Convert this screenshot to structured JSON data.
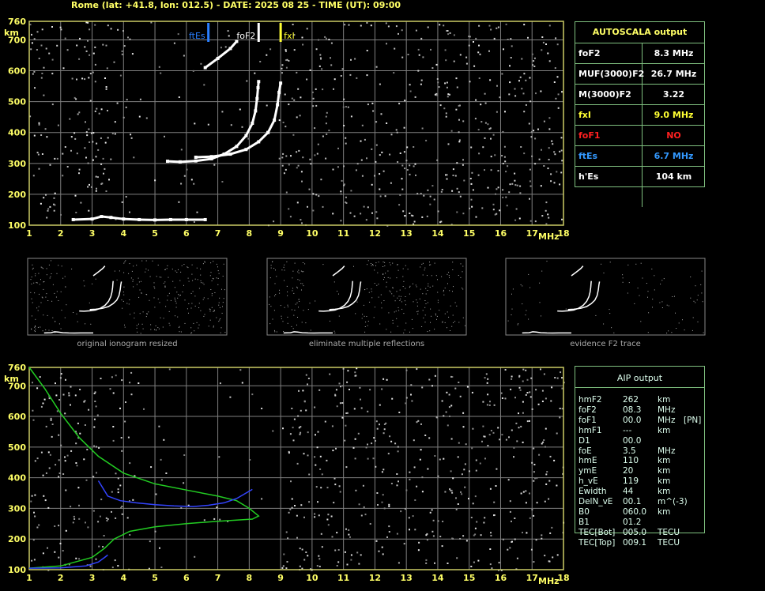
{
  "header": "Rome (lat: +41.8, lon: 012.5) - DATE: 2025 08 25 - TIME (UT): 09:00",
  "chart_data": [
    {
      "type": "scatter",
      "title": "",
      "xlabel": "MHz",
      "ylabel": "km",
      "xlim": [
        1,
        18
      ],
      "ylim": [
        100,
        760
      ],
      "xticks": [
        1,
        2,
        3,
        4,
        5,
        6,
        7,
        8,
        9,
        10,
        11,
        12,
        13,
        14,
        15,
        16,
        17,
        18
      ],
      "yticks": [
        100,
        200,
        300,
        400,
        500,
        600,
        700,
        760
      ],
      "grid": true,
      "markers": [
        {
          "name": "ftEs",
          "x": 6.7,
          "color": "#2a7fff"
        },
        {
          "name": "foF2",
          "x": 8.3,
          "color": "#ffffff"
        },
        {
          "name": "fxI",
          "x": 9.0,
          "color": "#ffff33"
        }
      ],
      "series": [
        {
          "name": "",
          "x": [
            5.4,
            5.8,
            6.3,
            6.8,
            7.2,
            7.6,
            7.9,
            8.1,
            8.2,
            8.25,
            8.28,
            8.3
          ],
          "y": [
            307,
            305,
            308,
            315,
            330,
            355,
            390,
            430,
            470,
            510,
            545,
            565
          ]
        },
        {
          "name": "",
          "x": [
            6.3,
            6.8,
            7.4,
            7.9,
            8.3,
            8.6,
            8.8,
            8.9,
            8.95,
            9.0
          ],
          "y": [
            320,
            322,
            330,
            345,
            370,
            400,
            440,
            490,
            530,
            560
          ]
        },
        {
          "name": "",
          "x": [
            2.4,
            3.0,
            3.3,
            3.6,
            4.0,
            4.5,
            5.0,
            5.5,
            6.0,
            6.6
          ],
          "y": [
            118,
            120,
            128,
            125,
            120,
            118,
            117,
            118,
            118,
            118
          ]
        },
        {
          "name": "",
          "x": [
            6.6,
            7.0,
            7.4,
            7.6
          ],
          "y": [
            610,
            640,
            672,
            695
          ]
        }
      ]
    },
    {
      "type": "line",
      "title": "",
      "xlabel": "MHz",
      "ylabel": "km",
      "xlim": [
        1,
        18
      ],
      "ylim": [
        100,
        760
      ],
      "xticks": [
        1,
        2,
        3,
        4,
        5,
        6,
        7,
        8,
        9,
        10,
        11,
        12,
        13,
        14,
        15,
        16,
        17,
        18
      ],
      "yticks": [
        100,
        200,
        300,
        400,
        500,
        600,
        700,
        760
      ],
      "grid": true,
      "series": [
        {
          "name": "",
          "color": "#22cc22",
          "x": [
            1.0,
            1.5,
            2.0,
            2.6,
            3.2,
            4.0,
            5.0,
            6.0,
            7.0,
            7.6,
            8.0,
            8.3,
            8.1,
            7.0,
            6.0,
            5.0,
            4.2,
            3.7,
            3.4,
            3.0,
            2.0,
            1.0
          ],
          "y": [
            760,
            690,
            610,
            530,
            470,
            415,
            380,
            360,
            340,
            325,
            300,
            275,
            265,
            258,
            250,
            240,
            225,
            200,
            170,
            140,
            112,
            105
          ]
        },
        {
          "name": "",
          "color": "#3344ff",
          "x": [
            3.2,
            3.5,
            3.9,
            4.4,
            5.0,
            5.6,
            6.2,
            6.7,
            7.2,
            7.6,
            7.9,
            8.1
          ],
          "y": [
            390,
            340,
            325,
            318,
            312,
            308,
            306,
            310,
            318,
            332,
            350,
            362
          ]
        },
        {
          "name": "",
          "color": "#3344ff",
          "x": [
            1.0,
            2.0,
            2.8,
            3.2,
            3.4,
            3.5
          ],
          "y": [
            105,
            106,
            112,
            125,
            140,
            148
          ]
        }
      ]
    }
  ],
  "autoscala": {
    "title": "AUTOSCALA output",
    "rows": [
      {
        "label": "foF2",
        "value": "8.3 MHz",
        "color": "#ffffff"
      },
      {
        "label": "MUF(3000)F2",
        "value": "26.7 MHz",
        "color": "#ffffff"
      },
      {
        "label": "M(3000)F2",
        "value": "3.22",
        "color": "#ffffff"
      },
      {
        "label": "fxI",
        "value": "9.0 MHz",
        "color": "#ffff33"
      },
      {
        "label": "foF1",
        "value": "NO",
        "color": "#ff2020"
      },
      {
        "label": "ftEs",
        "value": "6.7 MHz",
        "color": "#3399ff"
      },
      {
        "label": "h'Es",
        "value": "104 km",
        "color": "#ffffff"
      }
    ]
  },
  "aip": {
    "title": "AIP output",
    "rows": [
      {
        "name": "hmF2",
        "value": "262",
        "unit": "km",
        "extra": ""
      },
      {
        "name": "foF2",
        "value": "08.3",
        "unit": "MHz",
        "extra": ""
      },
      {
        "name": "foF1",
        "value": "00.0",
        "unit": "MHz",
        "extra": "[PN]"
      },
      {
        "name": "hmF1",
        "value": "---",
        "unit": "km",
        "extra": ""
      },
      {
        "name": "D1",
        "value": "00.0",
        "unit": "",
        "extra": ""
      },
      {
        "name": "foE",
        "value": "3.5",
        "unit": "MHz",
        "extra": ""
      },
      {
        "name": "hmE",
        "value": "110",
        "unit": "km",
        "extra": ""
      },
      {
        "name": "ymE",
        "value": "20",
        "unit": "km",
        "extra": ""
      },
      {
        "name": "h_vE",
        "value": "119",
        "unit": "km",
        "extra": ""
      },
      {
        "name": "Ewidth",
        "value": "44",
        "unit": "km",
        "extra": ""
      },
      {
        "name": "DelN_vE",
        "value": "00.1",
        "unit": "m^(-3)",
        "extra": ""
      },
      {
        "name": "B0",
        "value": "060.0",
        "unit": "km",
        "extra": ""
      },
      {
        "name": "B1",
        "value": "01.2",
        "unit": "",
        "extra": ""
      },
      {
        "name": "TEC[Bot]",
        "value": "005.0",
        "unit": "TECU",
        "extra": ""
      },
      {
        "name": "TEC[Top]",
        "value": "009.1",
        "unit": "TECU",
        "extra": ""
      }
    ]
  },
  "thumbnails": [
    {
      "caption": "original ionogram resized"
    },
    {
      "caption": "eliminate multiple reflections"
    },
    {
      "caption": "evidence F2 trace"
    }
  ],
  "colors": {
    "grid": "#7f7f7f",
    "frame": "#cccc66",
    "panel_border": "#7fbf7f",
    "axis_label": "#ffff66"
  }
}
